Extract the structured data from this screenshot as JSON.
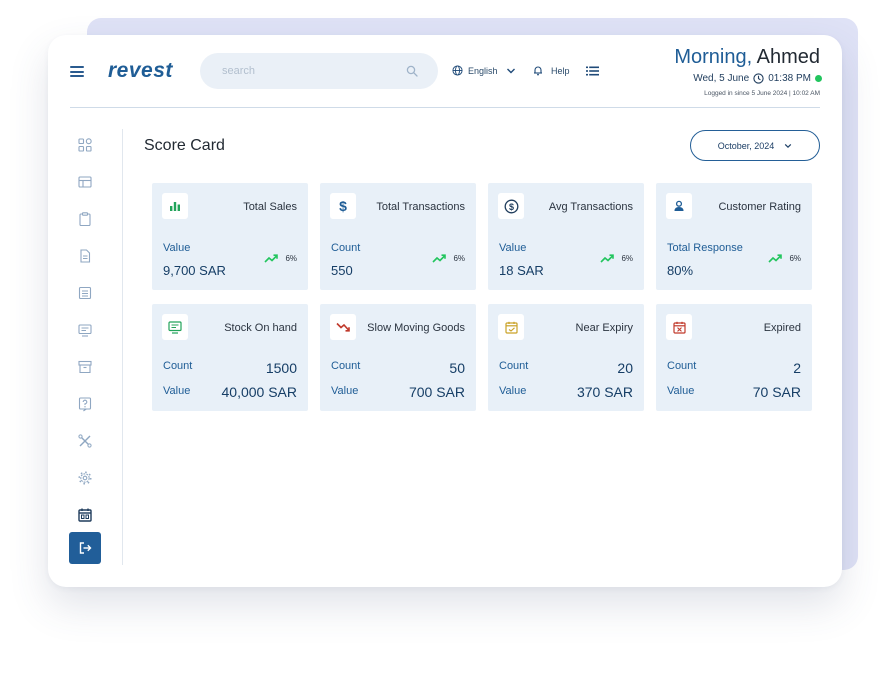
{
  "header": {
    "logo": "revest",
    "search_placeholder": "search",
    "language": "English",
    "help": "Help",
    "greeting_morning": "Morning,",
    "greeting_name": " Ahmed",
    "date": "Wed, 5 June",
    "time": "01:38 PM",
    "logged_in": "Logged in since 5 June 2024 | 10:02 AM"
  },
  "sidebar": {
    "icons": [
      "grid-icon",
      "layout-icon",
      "clipboard-icon",
      "document-icon",
      "list-document-icon",
      "monitor-icon",
      "archive-icon",
      "help-icon",
      "tools-icon",
      "gear-icon",
      "calendar-icon",
      "logout-icon"
    ]
  },
  "page": {
    "title": "Score Card",
    "date_filter": "October, 2024"
  },
  "cards_top": [
    {
      "title": "Total Sales",
      "label": "Value",
      "value": "9,700 SAR",
      "trend": "6%",
      "icon": "bar-chart-icon"
    },
    {
      "title": "Total Transactions",
      "label": "Count",
      "value": "550",
      "trend": "6%",
      "icon": "dollar-icon"
    },
    {
      "title": "Avg Transactions",
      "label": "Value",
      "value": "18 SAR",
      "trend": "6%",
      "icon": "dollar-circle-icon"
    },
    {
      "title": "Customer Rating",
      "label": "Total Response",
      "value": "80%",
      "trend": "6%",
      "icon": "user-icon"
    }
  ],
  "cards_bottom": [
    {
      "title": "Stock On hand",
      "label1": "Count",
      "value1": "1500",
      "label2": "Value",
      "value2": "40,000 SAR",
      "icon": "stock-icon"
    },
    {
      "title": "Slow Moving Goods",
      "label1": "Count",
      "value1": "50",
      "label2": "Value",
      "value2": "700 SAR",
      "icon": "trend-down-icon"
    },
    {
      "title": "Near Expiry",
      "label1": "Count",
      "value1": "20",
      "label2": "Value",
      "value2": "370 SAR",
      "icon": "calendar-warning-icon"
    },
    {
      "title": "Expired",
      "label1": "Count",
      "value1": "2",
      "label2": "Value",
      "value2": "70 SAR",
      "icon": "calendar-x-icon"
    }
  ],
  "colors": {
    "brand": "#1f5d96",
    "card_bg": "#e8f0f8",
    "trend_up": "#22c55e",
    "trend_down": "#c0392b",
    "status_online": "#22c55e"
  }
}
